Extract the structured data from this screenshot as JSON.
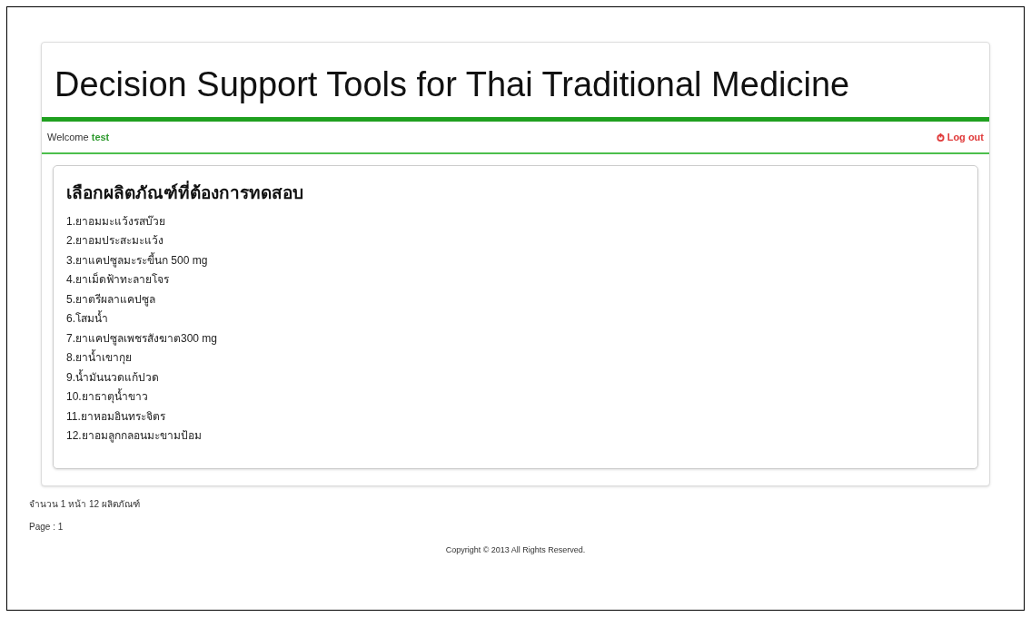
{
  "header": {
    "title": "Decision Support Tools for Thai Traditional Medicine"
  },
  "user_bar": {
    "welcome": "Welcome",
    "username": "test",
    "logout": "Log out"
  },
  "panel": {
    "heading": "เลือกผลิตภัณฑ์ที่ต้องการทดสอบ",
    "products": [
      "1.ยาอมมะแว้งรสบ๊วย",
      "2.ยาอมประสะมะแว้ง",
      "3.ยาแคปซูลมะระขี้นก 500 mg",
      "4.ยาเม็ดฟ้าทะลายโจร",
      "5.ยาตรีผลาแคปซูล",
      "6.โสมน้ำ",
      "7.ยาแคปซูลเพชรสังฆาต300 mg",
      "8.ยาน้ำเขากุย",
      "9.น้ำมันนวดแก้ปวด",
      "10.ยาธาตุน้ำขาว",
      "11.ยาหอมอินทระจิตร",
      "12.ยาอมลูกกลอนมะขามป้อม"
    ]
  },
  "summary": "จำนวน 1 หน้า 12 ผลิตภัณฑ์",
  "pagination": "Page : 1",
  "footer": "Copyright © 2013 All Rights Reserved."
}
